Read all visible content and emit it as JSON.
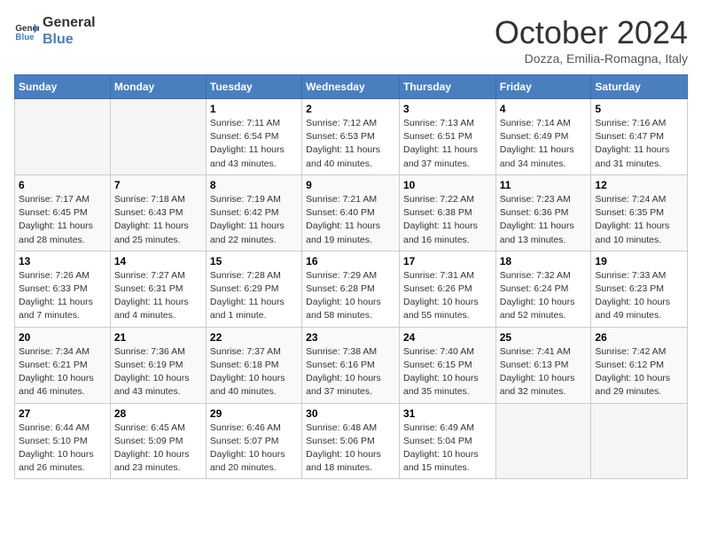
{
  "header": {
    "logo_line1": "General",
    "logo_line2": "Blue",
    "month": "October 2024",
    "location": "Dozza, Emilia-Romagna, Italy"
  },
  "days_of_week": [
    "Sunday",
    "Monday",
    "Tuesday",
    "Wednesday",
    "Thursday",
    "Friday",
    "Saturday"
  ],
  "weeks": [
    [
      {
        "day": "",
        "sunrise": "",
        "sunset": "",
        "daylight": ""
      },
      {
        "day": "",
        "sunrise": "",
        "sunset": "",
        "daylight": ""
      },
      {
        "day": "1",
        "sunrise": "Sunrise: 7:11 AM",
        "sunset": "Sunset: 6:54 PM",
        "daylight": "Daylight: 11 hours and 43 minutes."
      },
      {
        "day": "2",
        "sunrise": "Sunrise: 7:12 AM",
        "sunset": "Sunset: 6:53 PM",
        "daylight": "Daylight: 11 hours and 40 minutes."
      },
      {
        "day": "3",
        "sunrise": "Sunrise: 7:13 AM",
        "sunset": "Sunset: 6:51 PM",
        "daylight": "Daylight: 11 hours and 37 minutes."
      },
      {
        "day": "4",
        "sunrise": "Sunrise: 7:14 AM",
        "sunset": "Sunset: 6:49 PM",
        "daylight": "Daylight: 11 hours and 34 minutes."
      },
      {
        "day": "5",
        "sunrise": "Sunrise: 7:16 AM",
        "sunset": "Sunset: 6:47 PM",
        "daylight": "Daylight: 11 hours and 31 minutes."
      }
    ],
    [
      {
        "day": "6",
        "sunrise": "Sunrise: 7:17 AM",
        "sunset": "Sunset: 6:45 PM",
        "daylight": "Daylight: 11 hours and 28 minutes."
      },
      {
        "day": "7",
        "sunrise": "Sunrise: 7:18 AM",
        "sunset": "Sunset: 6:43 PM",
        "daylight": "Daylight: 11 hours and 25 minutes."
      },
      {
        "day": "8",
        "sunrise": "Sunrise: 7:19 AM",
        "sunset": "Sunset: 6:42 PM",
        "daylight": "Daylight: 11 hours and 22 minutes."
      },
      {
        "day": "9",
        "sunrise": "Sunrise: 7:21 AM",
        "sunset": "Sunset: 6:40 PM",
        "daylight": "Daylight: 11 hours and 19 minutes."
      },
      {
        "day": "10",
        "sunrise": "Sunrise: 7:22 AM",
        "sunset": "Sunset: 6:38 PM",
        "daylight": "Daylight: 11 hours and 16 minutes."
      },
      {
        "day": "11",
        "sunrise": "Sunrise: 7:23 AM",
        "sunset": "Sunset: 6:36 PM",
        "daylight": "Daylight: 11 hours and 13 minutes."
      },
      {
        "day": "12",
        "sunrise": "Sunrise: 7:24 AM",
        "sunset": "Sunset: 6:35 PM",
        "daylight": "Daylight: 11 hours and 10 minutes."
      }
    ],
    [
      {
        "day": "13",
        "sunrise": "Sunrise: 7:26 AM",
        "sunset": "Sunset: 6:33 PM",
        "daylight": "Daylight: 11 hours and 7 minutes."
      },
      {
        "day": "14",
        "sunrise": "Sunrise: 7:27 AM",
        "sunset": "Sunset: 6:31 PM",
        "daylight": "Daylight: 11 hours and 4 minutes."
      },
      {
        "day": "15",
        "sunrise": "Sunrise: 7:28 AM",
        "sunset": "Sunset: 6:29 PM",
        "daylight": "Daylight: 11 hours and 1 minute."
      },
      {
        "day": "16",
        "sunrise": "Sunrise: 7:29 AM",
        "sunset": "Sunset: 6:28 PM",
        "daylight": "Daylight: 10 hours and 58 minutes."
      },
      {
        "day": "17",
        "sunrise": "Sunrise: 7:31 AM",
        "sunset": "Sunset: 6:26 PM",
        "daylight": "Daylight: 10 hours and 55 minutes."
      },
      {
        "day": "18",
        "sunrise": "Sunrise: 7:32 AM",
        "sunset": "Sunset: 6:24 PM",
        "daylight": "Daylight: 10 hours and 52 minutes."
      },
      {
        "day": "19",
        "sunrise": "Sunrise: 7:33 AM",
        "sunset": "Sunset: 6:23 PM",
        "daylight": "Daylight: 10 hours and 49 minutes."
      }
    ],
    [
      {
        "day": "20",
        "sunrise": "Sunrise: 7:34 AM",
        "sunset": "Sunset: 6:21 PM",
        "daylight": "Daylight: 10 hours and 46 minutes."
      },
      {
        "day": "21",
        "sunrise": "Sunrise: 7:36 AM",
        "sunset": "Sunset: 6:19 PM",
        "daylight": "Daylight: 10 hours and 43 minutes."
      },
      {
        "day": "22",
        "sunrise": "Sunrise: 7:37 AM",
        "sunset": "Sunset: 6:18 PM",
        "daylight": "Daylight: 10 hours and 40 minutes."
      },
      {
        "day": "23",
        "sunrise": "Sunrise: 7:38 AM",
        "sunset": "Sunset: 6:16 PM",
        "daylight": "Daylight: 10 hours and 37 minutes."
      },
      {
        "day": "24",
        "sunrise": "Sunrise: 7:40 AM",
        "sunset": "Sunset: 6:15 PM",
        "daylight": "Daylight: 10 hours and 35 minutes."
      },
      {
        "day": "25",
        "sunrise": "Sunrise: 7:41 AM",
        "sunset": "Sunset: 6:13 PM",
        "daylight": "Daylight: 10 hours and 32 minutes."
      },
      {
        "day": "26",
        "sunrise": "Sunrise: 7:42 AM",
        "sunset": "Sunset: 6:12 PM",
        "daylight": "Daylight: 10 hours and 29 minutes."
      }
    ],
    [
      {
        "day": "27",
        "sunrise": "Sunrise: 6:44 AM",
        "sunset": "Sunset: 5:10 PM",
        "daylight": "Daylight: 10 hours and 26 minutes."
      },
      {
        "day": "28",
        "sunrise": "Sunrise: 6:45 AM",
        "sunset": "Sunset: 5:09 PM",
        "daylight": "Daylight: 10 hours and 23 minutes."
      },
      {
        "day": "29",
        "sunrise": "Sunrise: 6:46 AM",
        "sunset": "Sunset: 5:07 PM",
        "daylight": "Daylight: 10 hours and 20 minutes."
      },
      {
        "day": "30",
        "sunrise": "Sunrise: 6:48 AM",
        "sunset": "Sunset: 5:06 PM",
        "daylight": "Daylight: 10 hours and 18 minutes."
      },
      {
        "day": "31",
        "sunrise": "Sunrise: 6:49 AM",
        "sunset": "Sunset: 5:04 PM",
        "daylight": "Daylight: 10 hours and 15 minutes."
      },
      {
        "day": "",
        "sunrise": "",
        "sunset": "",
        "daylight": ""
      },
      {
        "day": "",
        "sunrise": "",
        "sunset": "",
        "daylight": ""
      }
    ]
  ]
}
